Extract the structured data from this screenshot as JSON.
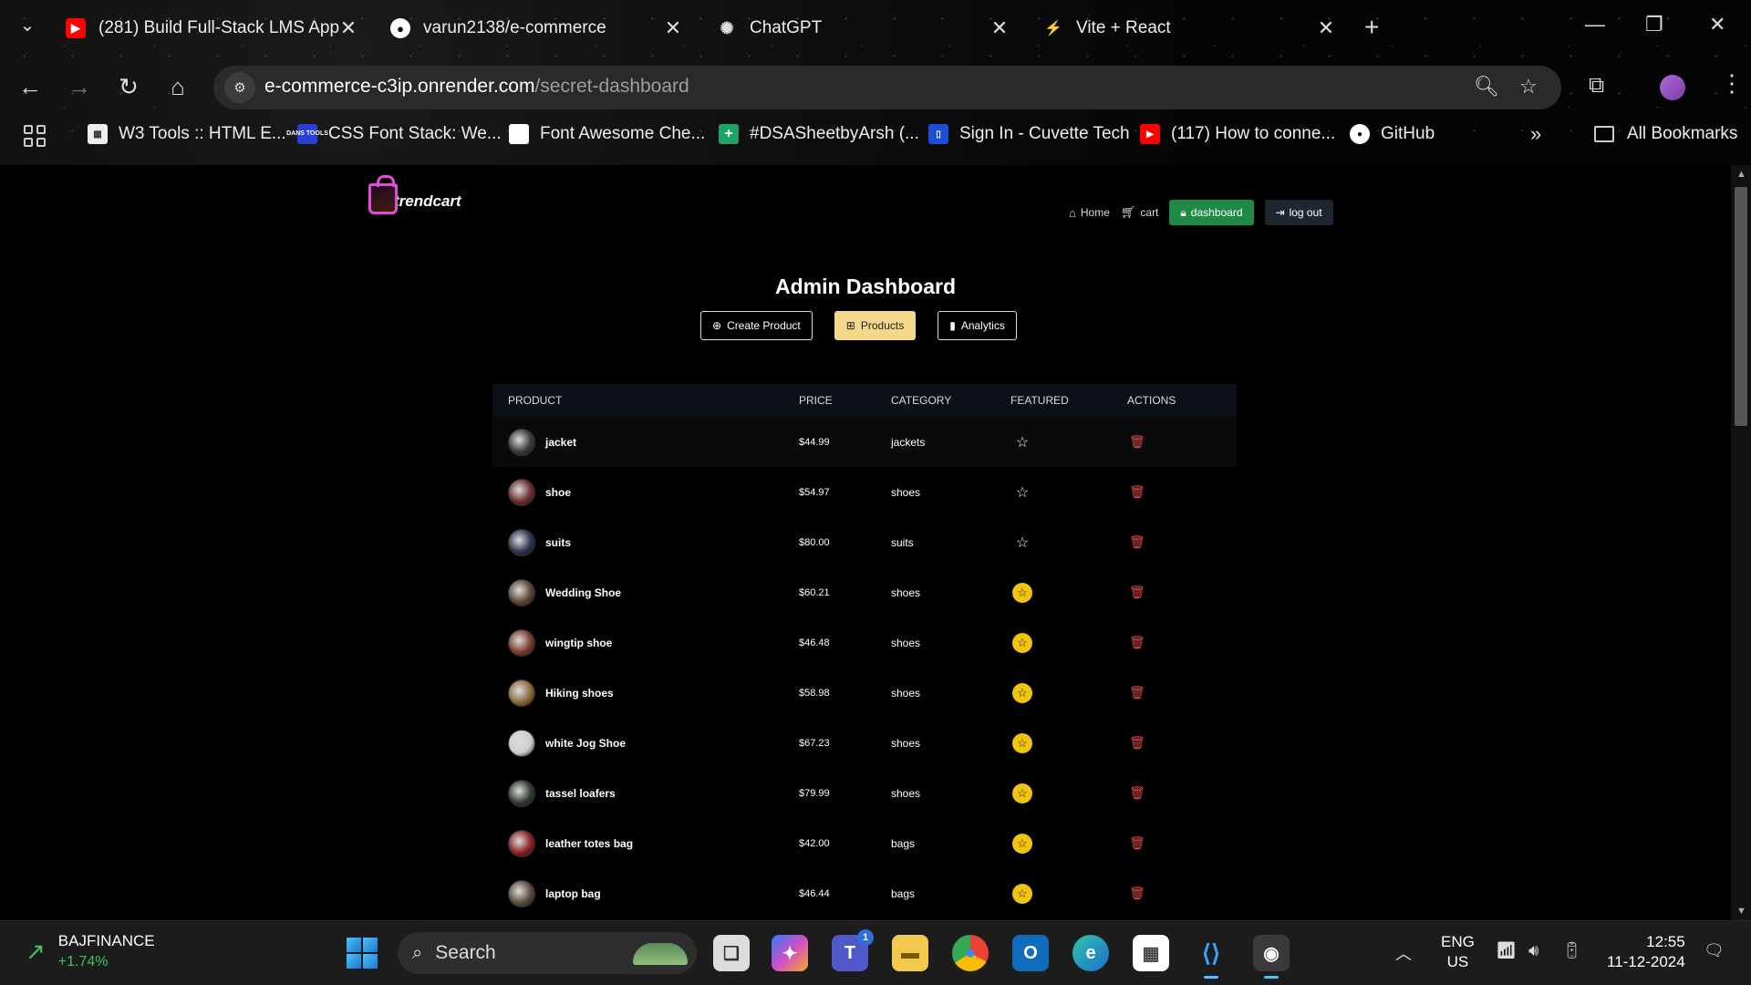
{
  "browser": {
    "tabs": [
      {
        "title": "(281) Build Full-Stack LMS App",
        "icon": "youtube-icon"
      },
      {
        "title": "varun2138/e-commerce",
        "icon": "github-icon"
      },
      {
        "title": "ChatGPT",
        "icon": "chatgpt-icon"
      },
      {
        "title": "Vite + React",
        "icon": "vite-icon"
      }
    ],
    "url_host": "e-commerce-c3ip.onrender.com",
    "url_path": "/secret-dashboard",
    "bookmarks": [
      {
        "label": "W3 Tools :: HTML E...",
        "icon": "w3tools-icon"
      },
      {
        "label": "CSS Font Stack: We...",
        "icon": "cssfontstack-icon",
        "icon_text": "DANS TOOLS"
      },
      {
        "label": "Font Awesome Che...",
        "icon": "fontawesome-icon"
      },
      {
        "label": "#DSASheetbyArsh (...",
        "icon": "sheets-icon"
      },
      {
        "label": "Sign In - Cuvette Tech",
        "icon": "cuvette-icon"
      },
      {
        "label": "(117) How to conne...",
        "icon": "youtube-icon"
      },
      {
        "label": "GitHub",
        "icon": "github-icon"
      }
    ],
    "all_bookmarks": "All Bookmarks"
  },
  "site": {
    "logo_text": "trendcart",
    "nav": {
      "home": "Home",
      "cart": "cart",
      "dashboard": "dashboard",
      "logout": "log out"
    }
  },
  "dashboard": {
    "title": "Admin Dashboard",
    "tabs": [
      {
        "label": "Create Product",
        "icon": "plus-circle-icon",
        "active": false
      },
      {
        "label": "Products",
        "icon": "basket-icon",
        "active": true
      },
      {
        "label": "Analytics",
        "icon": "bar-chart-icon",
        "active": false
      }
    ],
    "columns": [
      "PRODUCT",
      "PRICE",
      "CATEGORY",
      "FEATURED",
      "ACTIONS"
    ],
    "products": [
      {
        "name": "jacket",
        "price": "$44.99",
        "category": "jackets",
        "featured": false
      },
      {
        "name": "shoe",
        "price": "$54.97",
        "category": "shoes",
        "featured": false
      },
      {
        "name": "suits",
        "price": "$80.00",
        "category": "suits",
        "featured": false
      },
      {
        "name": "Wedding Shoe",
        "price": "$60.21",
        "category": "shoes",
        "featured": true
      },
      {
        "name": "wingtip shoe",
        "price": "$46.48",
        "category": "shoes",
        "featured": true
      },
      {
        "name": "Hiking shoes",
        "price": "$58.98",
        "category": "shoes",
        "featured": true
      },
      {
        "name": "white Jog Shoe",
        "price": "$67.23",
        "category": "shoes",
        "featured": true
      },
      {
        "name": "tassel loafers",
        "price": "$79.99",
        "category": "shoes",
        "featured": true
      },
      {
        "name": "leather totes bag",
        "price": "$42.00",
        "category": "bags",
        "featured": true
      },
      {
        "name": "laptop bag",
        "price": "$46.44",
        "category": "bags",
        "featured": true
      }
    ]
  },
  "taskbar": {
    "stock_name": "BAJFINANCE",
    "stock_change": "+1.74%",
    "search_label": "Search",
    "teams_badge": "1",
    "lang_line1": "ENG",
    "lang_line2": "US",
    "time": "12:55",
    "date": "11-12-2024"
  },
  "colors": {
    "accent_green": "#1f8a46",
    "active_tab": "#f3d78a",
    "featured_star": "#f1c40f",
    "delete_red": "#e04a4a"
  }
}
